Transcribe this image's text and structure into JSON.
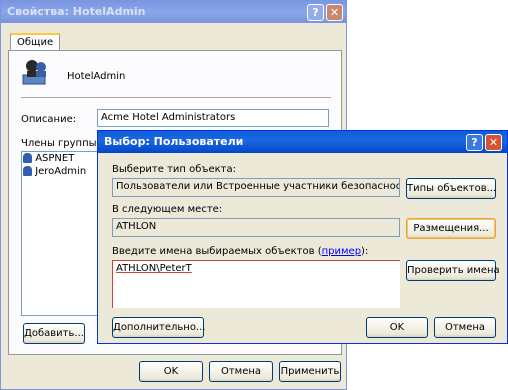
{
  "back_window": {
    "title": "Свойства: HotelAdmin",
    "tabs": [
      "Общие"
    ],
    "group_name": "HotelAdmin",
    "description_label": "Описание:",
    "description_value": "Acme Hotel Administrators",
    "members_label": "Члены группы:",
    "members": [
      "ASPNET",
      "JeroAdmin"
    ],
    "add_button": "Добавить...",
    "ok_button": "OK",
    "cancel_button": "Отмена",
    "apply_button": "Применить"
  },
  "dialog": {
    "title": "Выбор: Пользователи",
    "object_type_label": "Выберите тип объекта:",
    "object_type_value": "Пользователи или Встроенные участники безопасности",
    "object_types_button": "Типы объектов...",
    "location_label": "В следующем месте:",
    "location_value": "ATHLON",
    "locations_button": "Размещения...",
    "names_label": "Введите имена выбираемых объектов",
    "example_link": "пример",
    "names_value": "ATHLON\\PeterT",
    "check_names_button": "Проверить имена",
    "advanced_button": "Дополнительно...",
    "ok_button": "OK",
    "cancel_button": "Отмена"
  },
  "colors": {
    "title_active": "#0a5fd8",
    "title_inactive": "#7a96df",
    "dialog_face": "#ece9d8",
    "focus_border": "#e8a33b",
    "link": "#0000ff"
  }
}
